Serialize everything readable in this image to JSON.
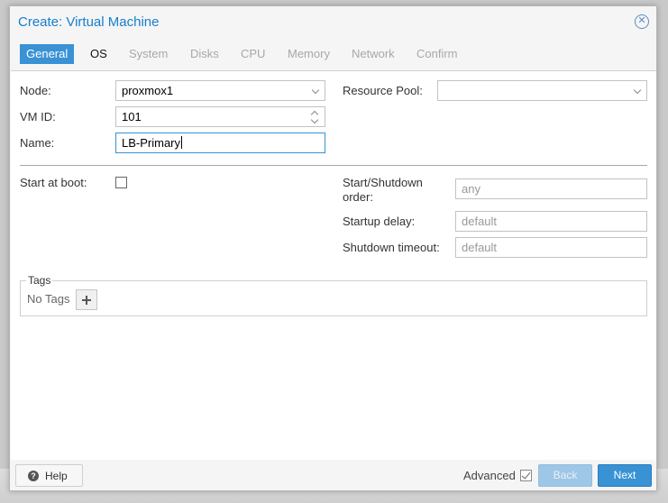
{
  "dialog": {
    "title": "Create: Virtual Machine",
    "close_icon": "close-icon"
  },
  "tabs": [
    {
      "label": "General",
      "state": "active"
    },
    {
      "label": "OS",
      "state": "enabled"
    },
    {
      "label": "System",
      "state": "disabled"
    },
    {
      "label": "Disks",
      "state": "disabled"
    },
    {
      "label": "CPU",
      "state": "disabled"
    },
    {
      "label": "Memory",
      "state": "disabled"
    },
    {
      "label": "Network",
      "state": "disabled"
    },
    {
      "label": "Confirm",
      "state": "disabled"
    }
  ],
  "general": {
    "node": {
      "label": "Node:",
      "value": "proxmox1"
    },
    "vmid": {
      "label": "VM ID:",
      "value": "101"
    },
    "name": {
      "label": "Name:",
      "value": "LB-Primary"
    },
    "resource_pool": {
      "label": "Resource Pool:",
      "value": ""
    },
    "start_at_boot": {
      "label": "Start at boot:",
      "checked": false
    },
    "start_order": {
      "label": "Start/Shutdown order:",
      "placeholder": "any"
    },
    "startup_delay": {
      "label": "Startup delay:",
      "placeholder": "default"
    },
    "shutdown_timeout": {
      "label": "Shutdown timeout:",
      "placeholder": "default"
    },
    "tags": {
      "legend": "Tags",
      "empty_text": "No Tags"
    }
  },
  "footer": {
    "help_label": "Help",
    "advanced_label": "Advanced",
    "advanced_checked": true,
    "back_label": "Back",
    "next_label": "Next"
  },
  "colors": {
    "accent": "#3892d4",
    "title": "#157fcc",
    "disabled_tab": "#a8a8a8",
    "back_disabled": "#9ec6e6"
  }
}
